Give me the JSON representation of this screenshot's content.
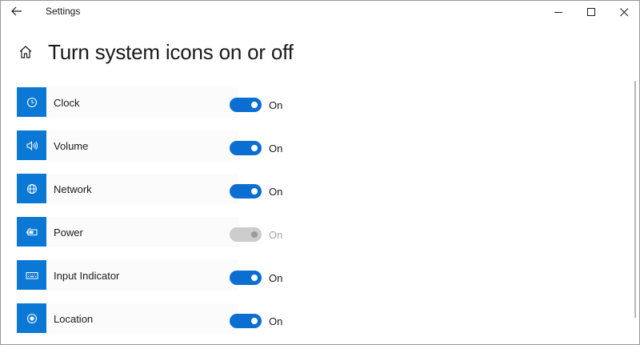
{
  "window": {
    "title": "Settings"
  },
  "header": {
    "title": "Turn system icons on or off"
  },
  "items": [
    {
      "label": "Clock",
      "icon": "clock-icon",
      "state": "On",
      "enabled": true
    },
    {
      "label": "Volume",
      "icon": "volume-icon",
      "state": "On",
      "enabled": true
    },
    {
      "label": "Network",
      "icon": "globe-icon",
      "state": "On",
      "enabled": true
    },
    {
      "label": "Power",
      "icon": "battery-icon",
      "state": "On",
      "enabled": false
    },
    {
      "label": "Input Indicator",
      "icon": "keyboard-icon",
      "state": "On",
      "enabled": true
    },
    {
      "label": "Location",
      "icon": "location-icon",
      "state": "On",
      "enabled": true
    }
  ],
  "colors": {
    "accent": "#0a78d4",
    "toggle_on": "#0a6fd0",
    "toggle_disabled": "#cccccc",
    "text": "#1a1a1a",
    "disabled_text": "#a6a6a6"
  }
}
